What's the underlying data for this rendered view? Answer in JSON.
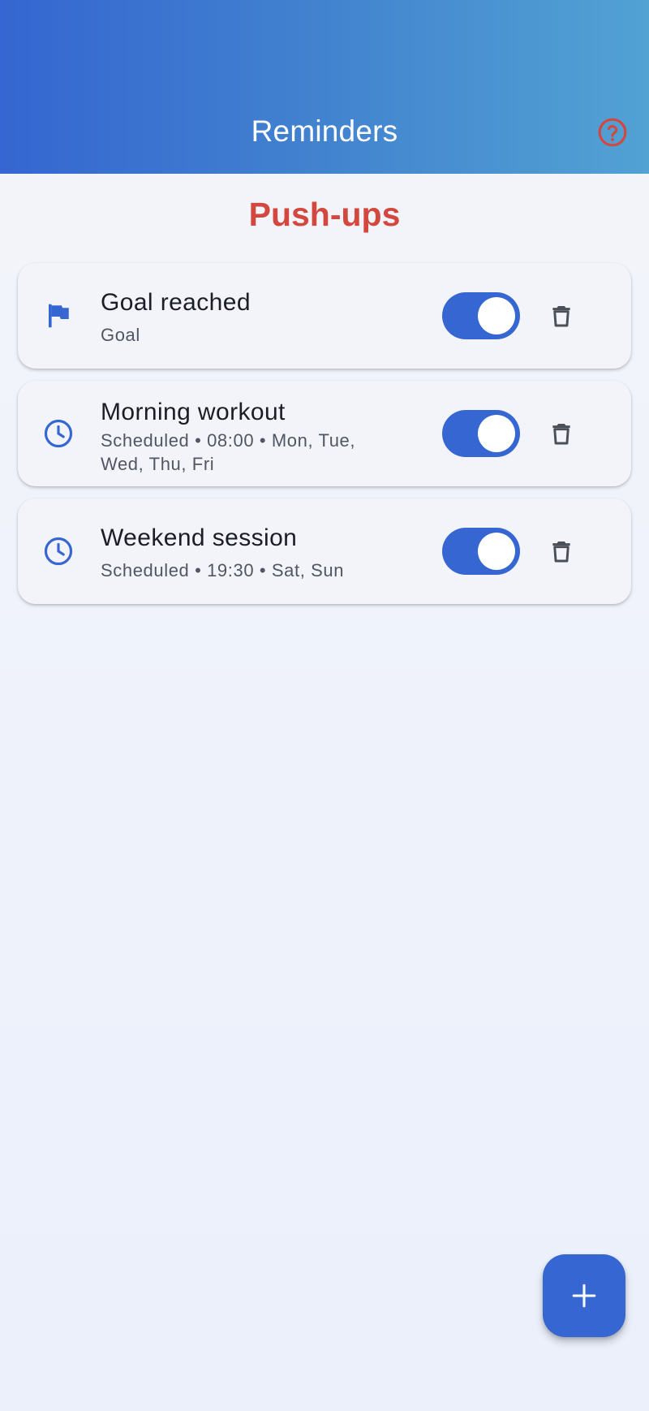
{
  "app_bar": {
    "title": "Reminders",
    "help_icon": "help-circle-icon",
    "help_color": "#d2483f"
  },
  "exercise": {
    "name": "Push-ups",
    "color": "#d2483f"
  },
  "reminders": [
    {
      "icon": "flag-icon",
      "title": "Goal reached",
      "subtitle": "Goal",
      "enabled": true
    },
    {
      "icon": "clock-icon",
      "title": "Morning workout",
      "subtitle": "Scheduled • 08:00 • Mon, Tue, Wed, Thu, Fri",
      "enabled": true
    },
    {
      "icon": "clock-icon",
      "title": "Weekend session",
      "subtitle": "Scheduled • 19:30 • Sat, Sun",
      "enabled": true
    }
  ],
  "fab": {
    "icon": "plus-icon"
  },
  "colors": {
    "accent": "#3566d1",
    "header_start": "#3566d1",
    "header_end": "#52a2d4",
    "card_bg": "#f2f4f9"
  }
}
